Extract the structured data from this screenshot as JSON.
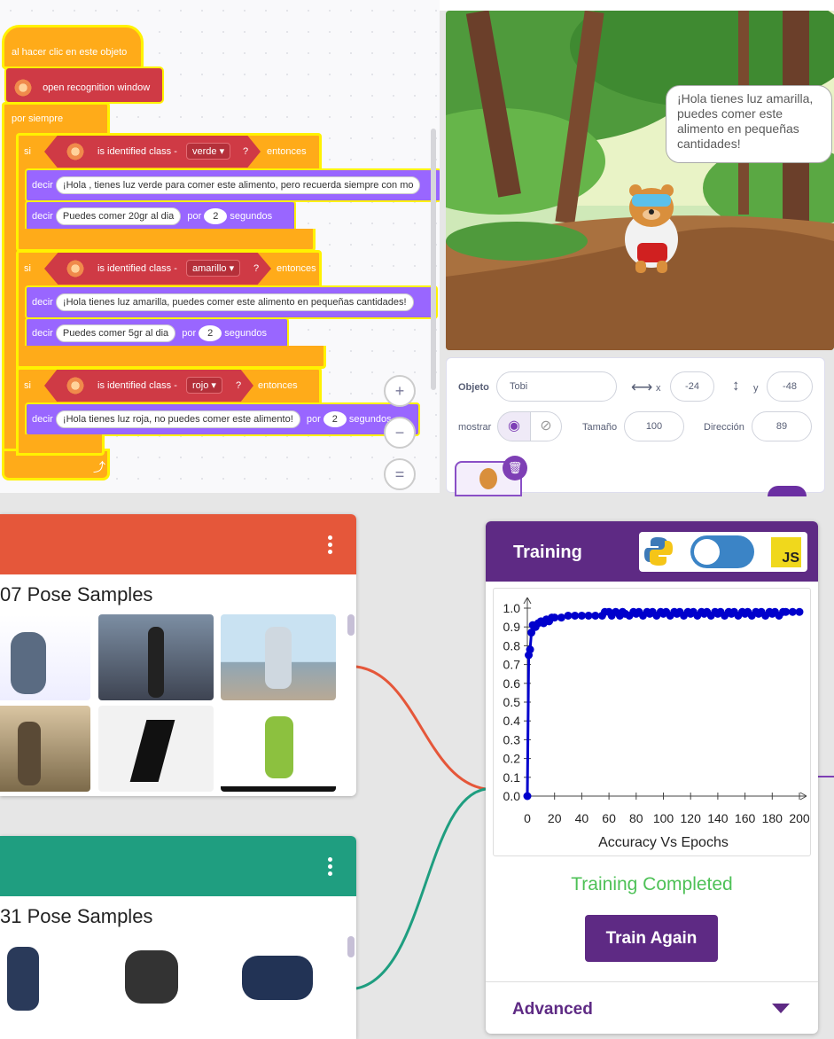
{
  "code": {
    "hat_label": "al hacer clic en este objeto",
    "open_window": "open recognition window",
    "forever": "por siempre",
    "if_label": "si",
    "then_label": "entonces",
    "identified": "is identified class -",
    "question": "?",
    "say": "decir",
    "for_label": "por",
    "seconds": "segundos",
    "branches": [
      {
        "class": "verde",
        "line1": "¡Hola , tienes luz verde para comer este alimento, pero recuerda siempre con mo",
        "line2": "Puedes comer 20gr al dia",
        "secs": "2"
      },
      {
        "class": "amarillo",
        "line1": "¡Hola tienes luz amarilla, puedes comer este alimento en pequeñas cantidades!",
        "line2": "Puedes comer 5gr al dia",
        "secs": "2"
      },
      {
        "class": "rojo",
        "line1": "¡Hola tienes luz roja, no puedes comer este alimento!",
        "secs": "2",
        "seconds_partial": "segundos"
      }
    ],
    "zoom_in": "+",
    "zoom_out": "−",
    "zoom_reset": "="
  },
  "stage": {
    "bubble": "¡Hola tienes luz amarilla, puedes comer este alimento en pequeñas cantidades!"
  },
  "sprite": {
    "object_label": "Objeto",
    "object_name": "Tobi",
    "x_label": "x",
    "x_value": "-24",
    "y_label": "y",
    "y_value": "-48",
    "show_label": "mostrar",
    "size_label": "Tamaño",
    "size_value": "100",
    "direction_label": "Dirección",
    "direction_value": "89"
  },
  "classes": [
    {
      "title": "07 Pose Samples",
      "color": "#e5573a"
    },
    {
      "title": "31 Pose Samples",
      "color": "#1f9e80"
    }
  ],
  "training": {
    "title": "Training",
    "js_label": "JS",
    "status": "Training Completed",
    "train_again": "Train Again",
    "advanced": "Advanced",
    "status_color": "#4ec157",
    "accent": "#5e2a84"
  },
  "chart_data": {
    "type": "line",
    "title": "",
    "xlabel": "Accuracy Vs Epochs",
    "ylabel": "",
    "xlim": [
      0,
      200
    ],
    "ylim": [
      0,
      1.0
    ],
    "x_ticks": [
      0,
      20,
      40,
      60,
      80,
      100,
      120,
      140,
      160,
      180,
      200
    ],
    "y_ticks": [
      0.0,
      0.1,
      0.2,
      0.3,
      0.4,
      0.5,
      0.6,
      0.7,
      0.8,
      0.9,
      1.0
    ],
    "series": [
      {
        "color": "#0000cc",
        "x": [
          0,
          1,
          2,
          3,
          4,
          6,
          8,
          10,
          12,
          14,
          16,
          18,
          20,
          25,
          30,
          35,
          40,
          45,
          50,
          55,
          57,
          60,
          62,
          65,
          68,
          70,
          72,
          75,
          78,
          80,
          82,
          85,
          88,
          90,
          92,
          95,
          98,
          100,
          102,
          105,
          108,
          110,
          112,
          115,
          118,
          120,
          122,
          125,
          128,
          130,
          132,
          135,
          138,
          140,
          142,
          145,
          148,
          150,
          152,
          155,
          158,
          160,
          162,
          165,
          168,
          170,
          172,
          175,
          178,
          180,
          182,
          185,
          188,
          190,
          195,
          200
        ],
        "y": [
          0.0,
          0.75,
          0.78,
          0.87,
          0.91,
          0.9,
          0.92,
          0.93,
          0.92,
          0.94,
          0.93,
          0.95,
          0.95,
          0.95,
          0.96,
          0.96,
          0.96,
          0.96,
          0.96,
          0.96,
          0.98,
          0.98,
          0.96,
          0.98,
          0.96,
          0.98,
          0.97,
          0.96,
          0.98,
          0.97,
          0.98,
          0.96,
          0.98,
          0.97,
          0.98,
          0.96,
          0.98,
          0.97,
          0.98,
          0.96,
          0.98,
          0.97,
          0.98,
          0.96,
          0.98,
          0.97,
          0.98,
          0.96,
          0.98,
          0.97,
          0.98,
          0.96,
          0.98,
          0.97,
          0.98,
          0.96,
          0.98,
          0.97,
          0.98,
          0.96,
          0.98,
          0.97,
          0.98,
          0.96,
          0.98,
          0.97,
          0.98,
          0.96,
          0.98,
          0.97,
          0.98,
          0.96,
          0.98,
          0.98,
          0.98,
          0.98
        ]
      }
    ]
  }
}
